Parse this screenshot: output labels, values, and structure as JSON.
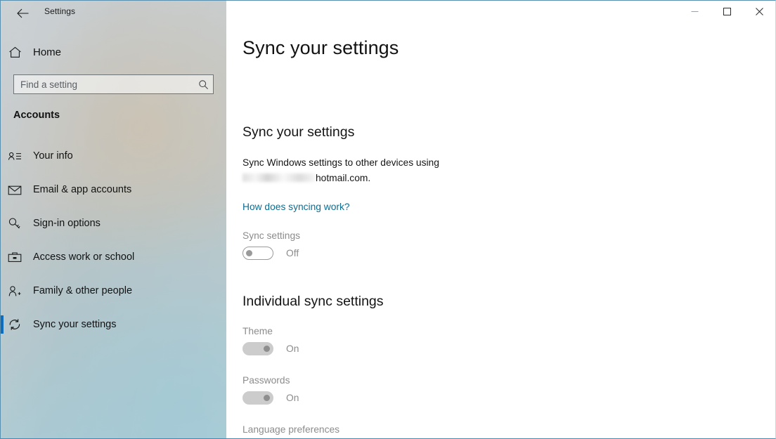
{
  "window": {
    "title": "Settings",
    "back_icon": "back-arrow-icon",
    "controls": {
      "minimize": "—",
      "maximize": "☐",
      "close": "✕"
    }
  },
  "sidebar": {
    "home_label": "Home",
    "home_icon": "home-icon",
    "search": {
      "placeholder": "Find a setting",
      "value": "",
      "icon": "search-icon"
    },
    "section_label": "Accounts",
    "items": [
      {
        "label": "Your info",
        "icon": "contact-card-icon",
        "selected": false
      },
      {
        "label": "Email & app accounts",
        "icon": "envelope-icon",
        "selected": false
      },
      {
        "label": "Sign-in options",
        "icon": "key-icon",
        "selected": false
      },
      {
        "label": "Access work or school",
        "icon": "briefcase-icon",
        "selected": false
      },
      {
        "label": "Family & other people",
        "icon": "person-add-icon",
        "selected": false
      },
      {
        "label": "Sync your settings",
        "icon": "sync-icon",
        "selected": true
      }
    ],
    "accent_color": "#0f6cbd"
  },
  "main": {
    "page_title": "Sync your settings",
    "group1_title": "Sync your settings",
    "description_prefix": "Sync Windows settings to other devices using",
    "description_suffix": "hotmail.com.",
    "link_label": "How does syncing work?",
    "link_color": "#0f6c91",
    "sync_setting": {
      "label": "Sync settings",
      "state": "Off",
      "on": false
    },
    "group2_title": "Individual sync settings",
    "individual": [
      {
        "label": "Theme",
        "state": "On",
        "on": true
      },
      {
        "label": "Passwords",
        "state": "On",
        "on": true
      },
      {
        "label": "Language preferences",
        "state": "",
        "on": true
      }
    ]
  }
}
